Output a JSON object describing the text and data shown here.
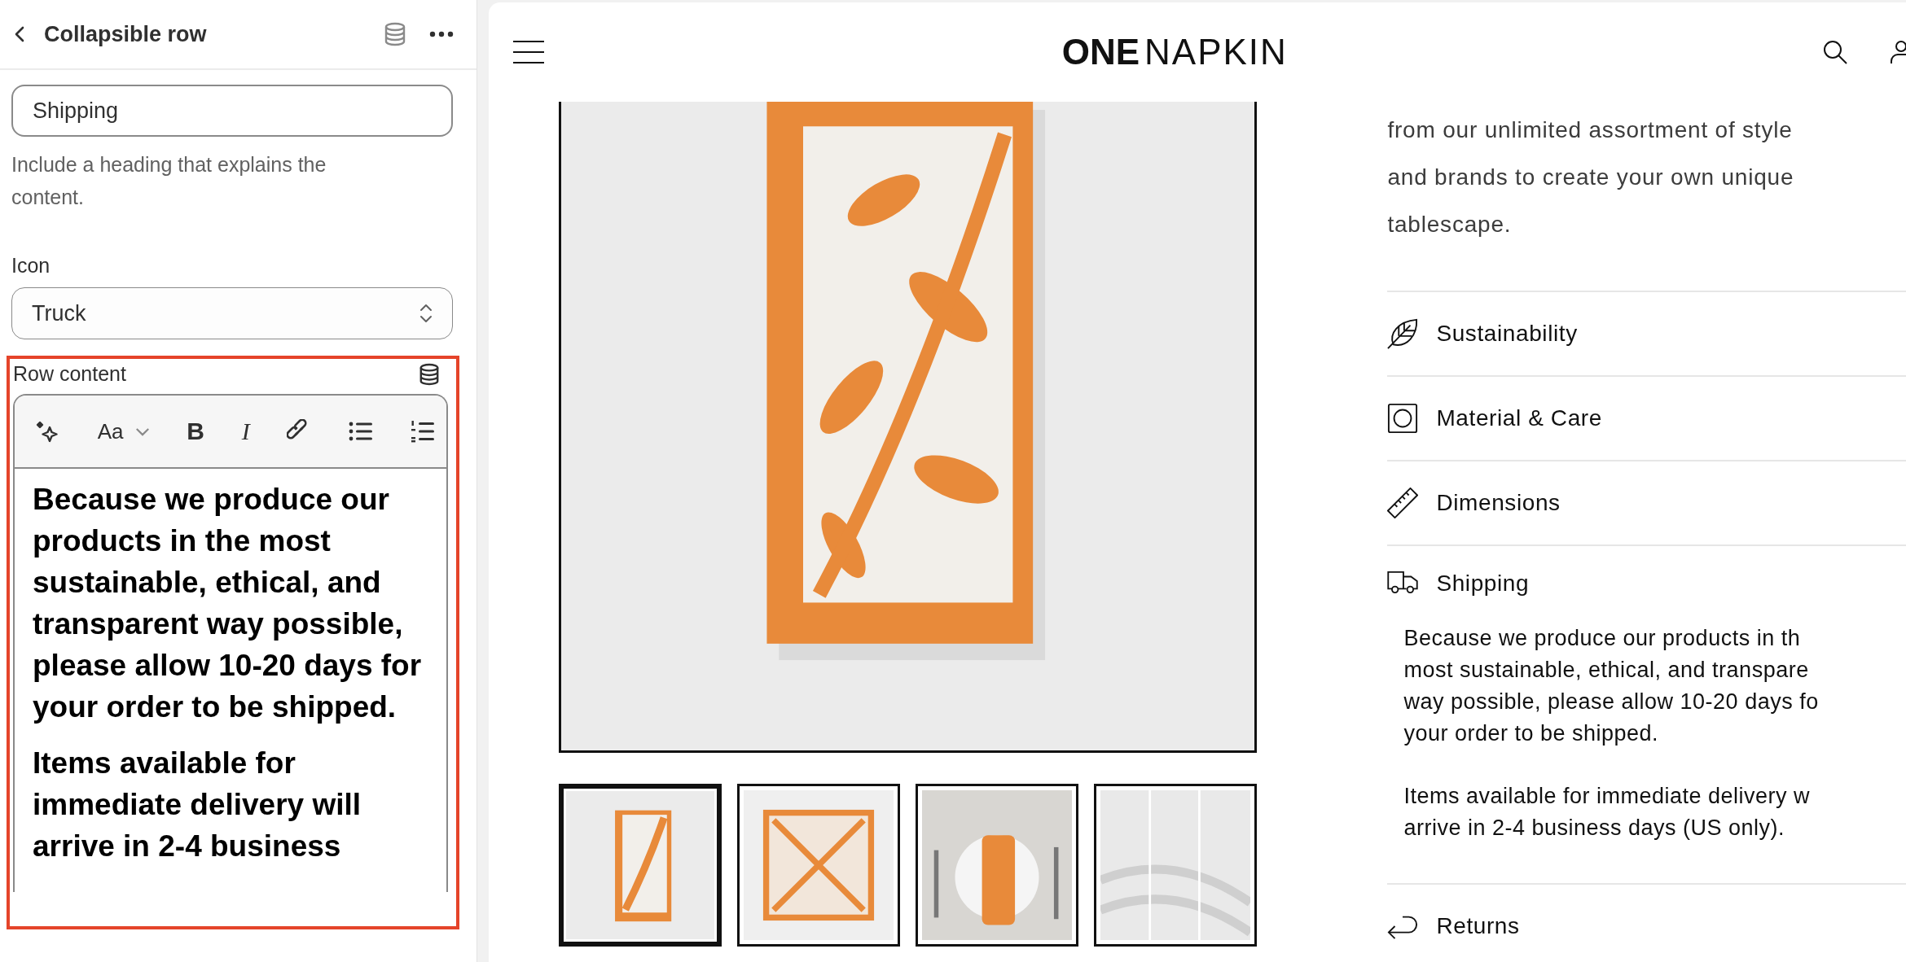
{
  "editor": {
    "title": "Collapsible row",
    "heading_field": {
      "value": "Shipping",
      "help": "Include a heading that explains the content."
    },
    "icon_field": {
      "label": "Icon",
      "value": "Truck"
    },
    "row_content": {
      "label": "Row content",
      "toolbar": [
        {
          "kind": "ai"
        },
        {
          "kind": "text-style",
          "label": "Aa"
        },
        {
          "kind": "bold",
          "label": "B"
        },
        {
          "kind": "italic",
          "label": "I"
        },
        {
          "kind": "link"
        },
        {
          "kind": "bullets"
        },
        {
          "kind": "numbers"
        }
      ],
      "paragraphs": [
        "Because we produce our products in the most sustainable, ethical, and transparent way possible, please allow 10-20 days for your order to be shipped.",
        "Items available for immediate delivery will arrive in 2-4 business"
      ]
    }
  },
  "preview": {
    "logo": {
      "bold": "ONE",
      "light": "NAPKIN"
    },
    "thumbnails": [
      {
        "kind": "folded",
        "selected": true
      },
      {
        "kind": "flat",
        "selected": false
      },
      {
        "kind": "table",
        "selected": false
      },
      {
        "kind": "fabric",
        "selected": false
      }
    ],
    "description": [
      "from our unlimited assortment of style",
      "and brands to create your own unique",
      "tablescape."
    ],
    "rows": [
      {
        "title": "Sustainability",
        "kind": "leaf",
        "expanded": false
      },
      {
        "title": "Material & Care",
        "kind": "care",
        "expanded": false
      },
      {
        "title": "Dimensions",
        "kind": "ruler",
        "expanded": false
      },
      {
        "title": "Shipping",
        "kind": "truck",
        "expanded": true,
        "body": [
          [
            "Because we produce our products in th",
            "most sustainable, ethical, and transpare",
            "way possible, please allow 10-20 days fo",
            "your order to be shipped."
          ],
          [
            "Items available for immediate delivery w",
            "arrive in 2-4 business days (US only)."
          ]
        ]
      },
      {
        "title": "Returns",
        "kind": "return",
        "expanded": false
      }
    ]
  }
}
